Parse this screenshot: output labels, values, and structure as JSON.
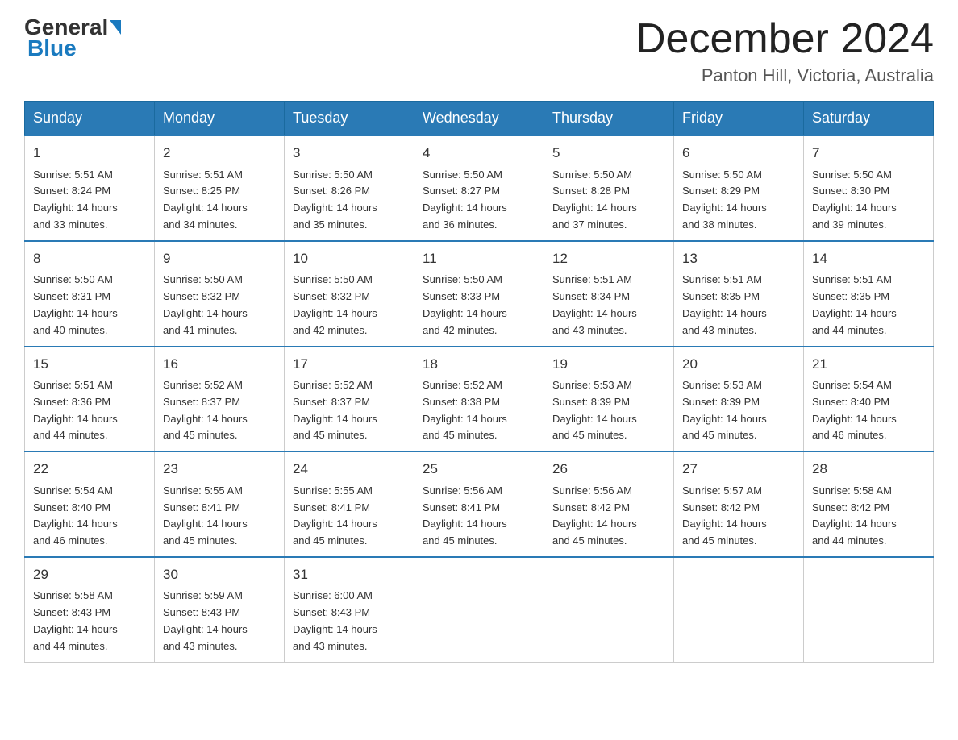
{
  "header": {
    "logo": {
      "part1": "General",
      "part2": "Blue"
    },
    "title": "December 2024",
    "location": "Panton Hill, Victoria, Australia"
  },
  "calendar": {
    "days_of_week": [
      "Sunday",
      "Monday",
      "Tuesday",
      "Wednesday",
      "Thursday",
      "Friday",
      "Saturday"
    ],
    "weeks": [
      [
        {
          "day": "1",
          "sunrise": "5:51 AM",
          "sunset": "8:24 PM",
          "daylight": "14 hours and 33 minutes."
        },
        {
          "day": "2",
          "sunrise": "5:51 AM",
          "sunset": "8:25 PM",
          "daylight": "14 hours and 34 minutes."
        },
        {
          "day": "3",
          "sunrise": "5:50 AM",
          "sunset": "8:26 PM",
          "daylight": "14 hours and 35 minutes."
        },
        {
          "day": "4",
          "sunrise": "5:50 AM",
          "sunset": "8:27 PM",
          "daylight": "14 hours and 36 minutes."
        },
        {
          "day": "5",
          "sunrise": "5:50 AM",
          "sunset": "8:28 PM",
          "daylight": "14 hours and 37 minutes."
        },
        {
          "day": "6",
          "sunrise": "5:50 AM",
          "sunset": "8:29 PM",
          "daylight": "14 hours and 38 minutes."
        },
        {
          "day": "7",
          "sunrise": "5:50 AM",
          "sunset": "8:30 PM",
          "daylight": "14 hours and 39 minutes."
        }
      ],
      [
        {
          "day": "8",
          "sunrise": "5:50 AM",
          "sunset": "8:31 PM",
          "daylight": "14 hours and 40 minutes."
        },
        {
          "day": "9",
          "sunrise": "5:50 AM",
          "sunset": "8:32 PM",
          "daylight": "14 hours and 41 minutes."
        },
        {
          "day": "10",
          "sunrise": "5:50 AM",
          "sunset": "8:32 PM",
          "daylight": "14 hours and 42 minutes."
        },
        {
          "day": "11",
          "sunrise": "5:50 AM",
          "sunset": "8:33 PM",
          "daylight": "14 hours and 42 minutes."
        },
        {
          "day": "12",
          "sunrise": "5:51 AM",
          "sunset": "8:34 PM",
          "daylight": "14 hours and 43 minutes."
        },
        {
          "day": "13",
          "sunrise": "5:51 AM",
          "sunset": "8:35 PM",
          "daylight": "14 hours and 43 minutes."
        },
        {
          "day": "14",
          "sunrise": "5:51 AM",
          "sunset": "8:35 PM",
          "daylight": "14 hours and 44 minutes."
        }
      ],
      [
        {
          "day": "15",
          "sunrise": "5:51 AM",
          "sunset": "8:36 PM",
          "daylight": "14 hours and 44 minutes."
        },
        {
          "day": "16",
          "sunrise": "5:52 AM",
          "sunset": "8:37 PM",
          "daylight": "14 hours and 45 minutes."
        },
        {
          "day": "17",
          "sunrise": "5:52 AM",
          "sunset": "8:37 PM",
          "daylight": "14 hours and 45 minutes."
        },
        {
          "day": "18",
          "sunrise": "5:52 AM",
          "sunset": "8:38 PM",
          "daylight": "14 hours and 45 minutes."
        },
        {
          "day": "19",
          "sunrise": "5:53 AM",
          "sunset": "8:39 PM",
          "daylight": "14 hours and 45 minutes."
        },
        {
          "day": "20",
          "sunrise": "5:53 AM",
          "sunset": "8:39 PM",
          "daylight": "14 hours and 45 minutes."
        },
        {
          "day": "21",
          "sunrise": "5:54 AM",
          "sunset": "8:40 PM",
          "daylight": "14 hours and 46 minutes."
        }
      ],
      [
        {
          "day": "22",
          "sunrise": "5:54 AM",
          "sunset": "8:40 PM",
          "daylight": "14 hours and 46 minutes."
        },
        {
          "day": "23",
          "sunrise": "5:55 AM",
          "sunset": "8:41 PM",
          "daylight": "14 hours and 45 minutes."
        },
        {
          "day": "24",
          "sunrise": "5:55 AM",
          "sunset": "8:41 PM",
          "daylight": "14 hours and 45 minutes."
        },
        {
          "day": "25",
          "sunrise": "5:56 AM",
          "sunset": "8:41 PM",
          "daylight": "14 hours and 45 minutes."
        },
        {
          "day": "26",
          "sunrise": "5:56 AM",
          "sunset": "8:42 PM",
          "daylight": "14 hours and 45 minutes."
        },
        {
          "day": "27",
          "sunrise": "5:57 AM",
          "sunset": "8:42 PM",
          "daylight": "14 hours and 45 minutes."
        },
        {
          "day": "28",
          "sunrise": "5:58 AM",
          "sunset": "8:42 PM",
          "daylight": "14 hours and 44 minutes."
        }
      ],
      [
        {
          "day": "29",
          "sunrise": "5:58 AM",
          "sunset": "8:43 PM",
          "daylight": "14 hours and 44 minutes."
        },
        {
          "day": "30",
          "sunrise": "5:59 AM",
          "sunset": "8:43 PM",
          "daylight": "14 hours and 43 minutes."
        },
        {
          "day": "31",
          "sunrise": "6:00 AM",
          "sunset": "8:43 PM",
          "daylight": "14 hours and 43 minutes."
        },
        null,
        null,
        null,
        null
      ]
    ],
    "labels": {
      "sunrise": "Sunrise:",
      "sunset": "Sunset:",
      "daylight": "Daylight:"
    }
  }
}
